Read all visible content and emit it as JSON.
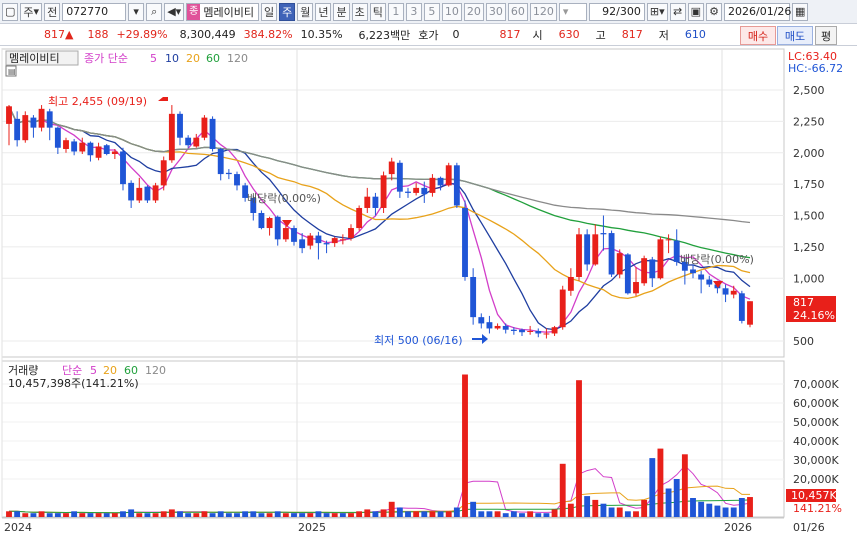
{
  "toolbar": {
    "market": "주",
    "jeon": "전",
    "code": "072770",
    "name_badge": "종",
    "name": "멤레이비티",
    "period_buttons": [
      "일",
      "주",
      "월",
      "년",
      "분",
      "초",
      "틱"
    ],
    "active_period": "주",
    "interval_buttons": [
      "1",
      "3",
      "5",
      "10",
      "20",
      "30",
      "60",
      "120"
    ],
    "count": "92/300",
    "date": "2026/01/26"
  },
  "quote": {
    "price": "817",
    "change": "188",
    "change_pct": "+29.89%",
    "volume": "8,300,449",
    "volume_ratio": "384.82%",
    "turnover": "10.35%",
    "amount": "6,223백만",
    "hoga_label": "호가",
    "hoga_value": "0",
    "hoga_price": "817",
    "open_label": "시",
    "open": "630",
    "high_label": "고",
    "high": "817",
    "low_label": "저",
    "low": "610",
    "buy": "매수",
    "sell": "매도",
    "eval": "평"
  },
  "price_panel": {
    "legend_name": "멤레이비티",
    "ma_label": "종가 단순",
    "ma_periods": [
      "5",
      "10",
      "20",
      "60",
      "120"
    ],
    "lc": "LC:63.40",
    "hc": "HC:-66.72",
    "high_annotation": "최고 2,455 (09/19)",
    "low_annotation": "최저 500 (06/16)",
    "div1": "배당락(0.00%)",
    "div2": "배당락(0.00%)",
    "price_tag": "817",
    "pct_tag": "24.16%"
  },
  "volume_panel": {
    "legend_name": "거래량",
    "ma_label": "단순",
    "ma_periods": [
      "5",
      "20",
      "60",
      "120"
    ],
    "total": "10,457,398주(141.21%)",
    "vol_tag": "10,457K",
    "pct_tag": "141.21%"
  },
  "colors": {
    "up": "#e8201a",
    "down": "#1f55d6",
    "ma5": "#d23ec9",
    "ma10": "#1f3ea0",
    "ma20": "#e8a21a",
    "ma60": "#21a03c",
    "ma120": "#8a8a8a",
    "buy_bg": "#fde9e8",
    "sell_bg": "#e8eefb"
  },
  "chart_data": [
    {
      "type": "candlestick",
      "yaxis_ticks": [
        2500,
        2250,
        2000,
        1750,
        1500,
        1250,
        1000,
        500
      ],
      "xaxis_ticks": [
        "2024",
        "2025",
        "2026",
        "01/26"
      ],
      "ohlc": [
        [
          2230,
          2370,
          2060,
          2380
        ],
        [
          2270,
          2100,
          2050,
          2330
        ],
        [
          2100,
          2300,
          2080,
          2330
        ],
        [
          2280,
          2200,
          2120,
          2300
        ],
        [
          2200,
          2350,
          2170,
          2380
        ],
        [
          2330,
          2200,
          2100,
          2350
        ],
        [
          2200,
          2040,
          1990,
          2210
        ],
        [
          2030,
          2100,
          2000,
          2120
        ],
        [
          2090,
          2010,
          1980,
          2110
        ],
        [
          2010,
          2080,
          1990,
          2120
        ],
        [
          2080,
          1980,
          1930,
          2090
        ],
        [
          1960,
          2050,
          1940,
          2080
        ],
        [
          2060,
          1990,
          1980,
          2070
        ],
        [
          1990,
          2010,
          1950,
          2030
        ],
        [
          2010,
          1750,
          1700,
          2040
        ],
        [
          1760,
          1620,
          1560,
          1780
        ],
        [
          1620,
          1720,
          1600,
          1800
        ],
        [
          1730,
          1620,
          1600,
          1740
        ],
        [
          1620,
          1740,
          1600,
          1760
        ],
        [
          1740,
          1940,
          1700,
          1970
        ],
        [
          1940,
          2310,
          1920,
          2380
        ],
        [
          2310,
          2120,
          2060,
          2330
        ],
        [
          2120,
          2060,
          2040,
          2140
        ],
        [
          2050,
          2120,
          2040,
          2150
        ],
        [
          2120,
          2280,
          2100,
          2300
        ],
        [
          2270,
          2030,
          2010,
          2290
        ],
        [
          2030,
          1830,
          1780,
          2040
        ],
        [
          1840,
          1830,
          1790,
          1870
        ],
        [
          1830,
          1740,
          1700,
          1850
        ],
        [
          1740,
          1640,
          1610,
          1760
        ],
        [
          1640,
          1520,
          1460,
          1660
        ],
        [
          1520,
          1400,
          1390,
          1540
        ],
        [
          1400,
          1480,
          1340,
          1490
        ],
        [
          1490,
          1310,
          1260,
          1500
        ],
        [
          1310,
          1400,
          1290,
          1420
        ],
        [
          1400,
          1290,
          1260,
          1420
        ],
        [
          1310,
          1240,
          1200,
          1360
        ],
        [
          1260,
          1340,
          1230,
          1360
        ],
        [
          1340,
          1280,
          1150,
          1370
        ],
        [
          1280,
          1270,
          1200,
          1300
        ],
        [
          1280,
          1320,
          1250,
          1330
        ],
        [
          1310,
          1310,
          1270,
          1350
        ],
        [
          1320,
          1400,
          1300,
          1430
        ],
        [
          1400,
          1560,
          1380,
          1580
        ],
        [
          1560,
          1650,
          1520,
          1720
        ],
        [
          1650,
          1560,
          1500,
          1680
        ],
        [
          1560,
          1820,
          1520,
          1850
        ],
        [
          1830,
          1930,
          1780,
          1960
        ],
        [
          1920,
          1690,
          1640,
          1940
        ],
        [
          1690,
          1680,
          1640,
          1720
        ],
        [
          1680,
          1720,
          1660,
          1760
        ],
        [
          1720,
          1670,
          1600,
          1770
        ],
        [
          1680,
          1800,
          1650,
          1830
        ],
        [
          1800,
          1740,
          1700,
          1810
        ],
        [
          1740,
          1900,
          1730,
          1920
        ],
        [
          1900,
          1580,
          1560,
          1920
        ],
        [
          1560,
          1010,
          980,
          1620
        ],
        [
          1010,
          690,
          630,
          1080
        ],
        [
          690,
          640,
          600,
          720
        ],
        [
          650,
          600,
          560,
          700
        ],
        [
          600,
          620,
          590,
          640
        ],
        [
          620,
          590,
          560,
          640
        ],
        [
          590,
          580,
          550,
          610
        ],
        [
          590,
          570,
          540,
          600
        ],
        [
          580,
          580,
          550,
          620
        ],
        [
          580,
          560,
          530,
          600
        ],
        [
          560,
          560,
          520,
          600
        ],
        [
          560,
          610,
          540,
          620
        ],
        [
          610,
          910,
          590,
          940
        ],
        [
          900,
          1010,
          860,
          1080
        ],
        [
          1010,
          1350,
          980,
          1400
        ],
        [
          1350,
          1110,
          1060,
          1390
        ],
        [
          1110,
          1350,
          1100,
          1430
        ],
        [
          1360,
          1350,
          1220,
          1500
        ],
        [
          1360,
          1030,
          1010,
          1380
        ],
        [
          1030,
          1200,
          1000,
          1230
        ],
        [
          1190,
          880,
          870,
          1200
        ],
        [
          880,
          970,
          860,
          1090
        ],
        [
          960,
          1160,
          940,
          1180
        ],
        [
          1150,
          1000,
          930,
          1170
        ],
        [
          1000,
          1310,
          990,
          1330
        ],
        [
          1310,
          1310,
          1200,
          1350
        ],
        [
          1300,
          1130,
          1100,
          1390
        ],
        [
          1130,
          1060,
          950,
          1160
        ],
        [
          1070,
          1040,
          1000,
          1110
        ],
        [
          1030,
          990,
          880,
          1060
        ],
        [
          990,
          950,
          930,
          1020
        ],
        [
          950,
          920,
          880,
          980
        ],
        [
          920,
          870,
          810,
          950
        ],
        [
          870,
          900,
          840,
          940
        ],
        [
          880,
          660,
          640,
          900
        ],
        [
          630,
          817,
          610,
          817
        ]
      ]
    },
    {
      "type": "bar",
      "name": "거래량",
      "yaxis_ticks": [
        "70,000K",
        "60,000K",
        "50,000K",
        "40,000K",
        "30,000K",
        "20,000K"
      ],
      "values": [
        3,
        3,
        2,
        2,
        3,
        2,
        2,
        2,
        3,
        2,
        2,
        2,
        2,
        2,
        3,
        4,
        2,
        2,
        2,
        3,
        4,
        3,
        2,
        2,
        3,
        2,
        3,
        2,
        2,
        3,
        3,
        2,
        2,
        3,
        2,
        2,
        2,
        2,
        3,
        2,
        2,
        2,
        2,
        3,
        4,
        3,
        4,
        8,
        5,
        3,
        3,
        3,
        3,
        3,
        3,
        5,
        75,
        8,
        3,
        3,
        3,
        2,
        3,
        2,
        3,
        2,
        2,
        4,
        28,
        7,
        72,
        11,
        9,
        7,
        5,
        5,
        3,
        3,
        9,
        31,
        36,
        15,
        20,
        33,
        10,
        8,
        7,
        6,
        5,
        5,
        10,
        10.5
      ],
      "up": [
        1,
        0,
        1,
        0,
        1,
        0,
        0,
        1,
        0,
        1,
        0,
        1,
        0,
        1,
        0,
        0,
        1,
        0,
        1,
        1,
        1,
        0,
        0,
        1,
        1,
        0,
        0,
        0,
        0,
        0,
        0,
        0,
        1,
        0,
        1,
        0,
        0,
        1,
        0,
        0,
        1,
        0,
        1,
        1,
        1,
        0,
        1,
        1,
        0,
        0,
        1,
        0,
        1,
        0,
        1,
        0,
        1,
        0,
        0,
        0,
        1,
        0,
        0,
        0,
        1,
        0,
        0,
        1,
        1,
        1,
        1,
        0,
        1,
        0,
        0,
        1,
        0,
        1,
        1,
        0,
        1,
        0,
        0,
        1,
        0,
        0,
        0,
        0,
        0,
        0,
        0,
        1
      ]
    }
  ]
}
